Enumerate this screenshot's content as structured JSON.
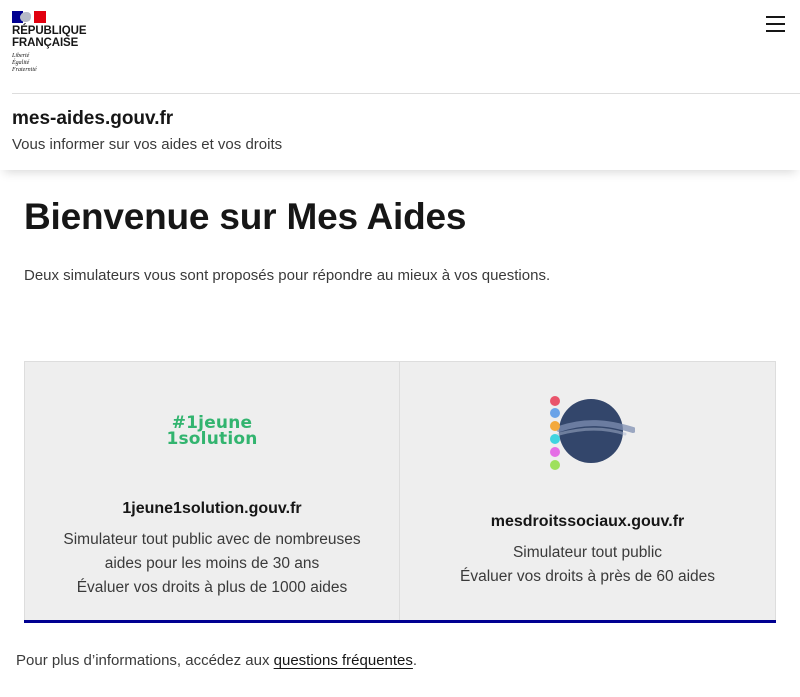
{
  "header": {
    "republic_line1": "RÉPUBLIQUE",
    "republic_line2": "FRANÇAISE",
    "motto": [
      "Liberté",
      "Égalité",
      "Fraternité"
    ],
    "site_title": "mes-aides.gouv.fr",
    "tagline": "Vous informer sur vos aides et vos droits",
    "menu_icon": "hamburger-menu-icon"
  },
  "main": {
    "title": "Bienvenue sur Mes Aides",
    "intro": "Deux simulateurs vous sont proposés pour répondre au mieux à vos questions.",
    "cards": [
      {
        "logo_line1": "#1jeune",
        "logo_line2": "1solution",
        "name": "1jeune1solution.gouv.fr",
        "description": [
          "Simulateur tout public avec de nombreuses",
          "aides pour les moins de 30 ans",
          "Évaluer vos droits à plus de 1000 aides"
        ]
      },
      {
        "logo_icon": "mesdroitssociaux-logo-icon",
        "name": "mesdroitssociaux.gouv.fr",
        "description": [
          "Simulateur tout public",
          "Évaluer vos droits à près de 60 aides"
        ]
      }
    ]
  },
  "footer": {
    "text_before": "Pour plus d’informations, accédez aux ",
    "link_label": "questions fréquentes",
    "text_after": "."
  },
  "colors": {
    "accent_blue": "#000091",
    "french_red": "#e1000f",
    "jeune_green": "#32b46f",
    "card_background": "#eeeeee",
    "mds_globe": "#33466b"
  }
}
